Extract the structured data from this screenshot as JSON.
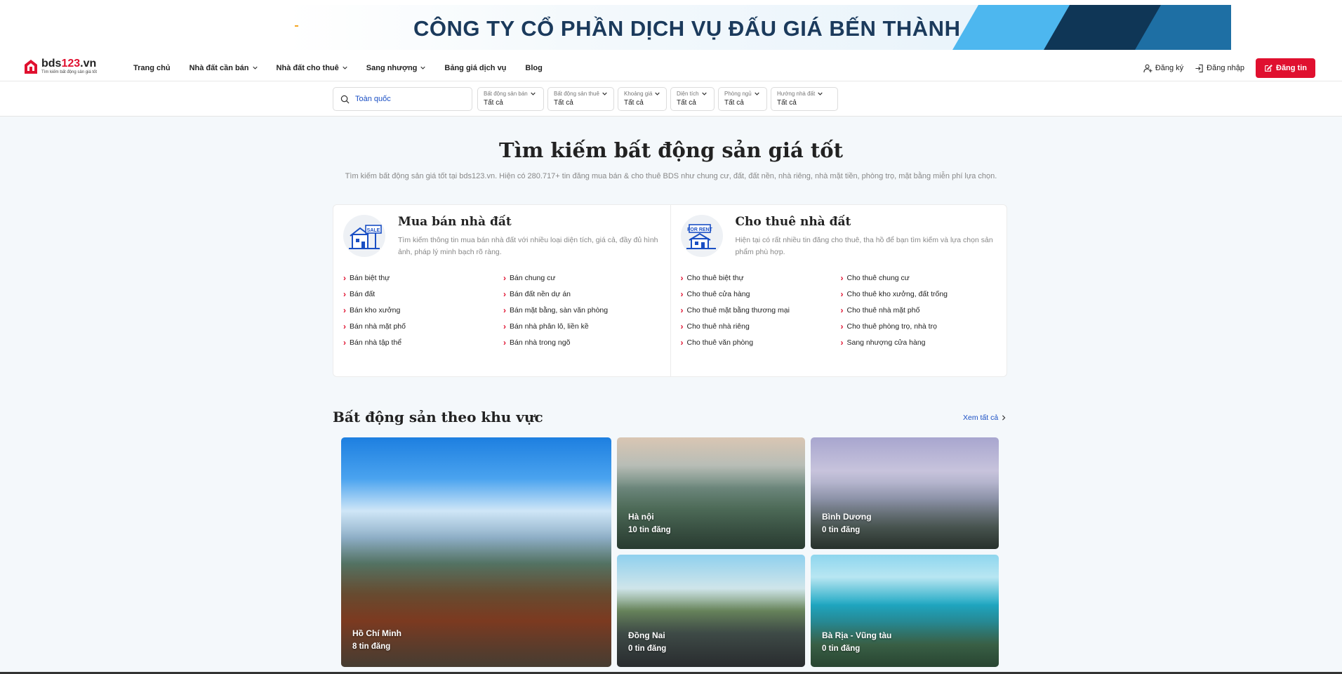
{
  "banner": {
    "text": "CÔNG TY CỔ PHẦN DỊCH VỤ ĐẤU GIÁ BẾN THÀNH"
  },
  "logo": {
    "name_main": "bds",
    "name_num": "123",
    "name_tld": ".vn",
    "tagline": "Tìm kiếm bất động sản giá tốt"
  },
  "nav": {
    "items": [
      {
        "label": "Trang chủ",
        "dropdown": false
      },
      {
        "label": "Nhà đất cần bán",
        "dropdown": true
      },
      {
        "label": "Nhà đất cho thuê",
        "dropdown": true
      },
      {
        "label": "Sang nhượng",
        "dropdown": true
      },
      {
        "label": "Bảng giá dịch vụ",
        "dropdown": false
      },
      {
        "label": "Blog",
        "dropdown": false
      }
    ]
  },
  "auth": {
    "register": "Đăng ký",
    "login": "Đăng nhập",
    "post": "Đăng tin"
  },
  "search": {
    "location": "Toàn quốc",
    "filters": [
      {
        "label": "Bất động sản bán",
        "value": "Tất cả"
      },
      {
        "label": "Bất động sản thuê",
        "value": "Tất cả"
      },
      {
        "label": "Khoảng giá",
        "value": "Tất cả"
      },
      {
        "label": "Diện tích",
        "value": "Tất cả"
      },
      {
        "label": "Phòng ngủ",
        "value": "Tất cả"
      },
      {
        "label": "Hướng nhà đất",
        "value": "Tất cả"
      }
    ]
  },
  "hero": {
    "title": "Tìm kiếm bất động sản giá tốt",
    "subtitle": "Tìm kiếm bất động sản giá tốt tại bds123.vn. Hiện có 280.717+ tin đăng mua bán & cho thuê BDS như chung cư, đất, đất nền, nhà riêng, nhà mặt tiền, phòng trọ, mặt bằng miễn phí lựa chọn."
  },
  "categories": [
    {
      "title": "Mua bán nhà đất",
      "icon_badge": "SALE",
      "description": "Tìm kiếm thông tin mua bán nhà đất với nhiều loại diện tích, giá cả, đầy đủ hình ảnh, pháp lý minh bạch rõ ràng.",
      "links": [
        "Bán biệt thự",
        "Bán chung cư",
        "Bán đất",
        "Bán đất nền dự án",
        "Bán kho xưởng",
        "Bán mặt bằng, sàn văn phòng",
        "Bán nhà mặt phố",
        "Bán nhà phân lô, liền kề",
        "Bán nhà tập thể",
        "Bán nhà trong ngõ"
      ]
    },
    {
      "title": "Cho thuê nhà đất",
      "icon_badge": "FOR RENT",
      "description": "Hiện tại có rất nhiều tin đăng cho thuê, tha hồ để bạn tìm kiếm và lựa chọn sản phẩm phù hợp.",
      "links": [
        "Cho thuê biệt thự",
        "Cho thuê chung cư",
        "Cho thuê cửa hàng",
        "Cho thuê kho xưởng, đất trống",
        "Cho thuê mặt bằng thương mại",
        "Cho thuê nhà mặt phố",
        "Cho thuê nhà riêng",
        "Cho thuê phòng trọ, nhà trọ",
        "Cho thuê văn phòng",
        "Sang nhượng cửa hàng"
      ]
    }
  ],
  "regions": {
    "title": "Bất động sản theo khu vực",
    "see_all": "Xem tất cả",
    "items": [
      {
        "name": "Hồ Chí Minh",
        "count": "8 tin đăng"
      },
      {
        "name": "Hà nội",
        "count": "10 tin đăng"
      },
      {
        "name": "Bình Dương",
        "count": "0 tin đăng"
      },
      {
        "name": "Đồng Nai",
        "count": "0 tin đăng"
      },
      {
        "name": "Bà Rịa - Vũng tàu",
        "count": "0 tin đăng"
      }
    ]
  },
  "colors": {
    "brand_red": "#e0102f",
    "link_blue": "#1a4fc4",
    "banner_navy": "#1b3a5c"
  }
}
